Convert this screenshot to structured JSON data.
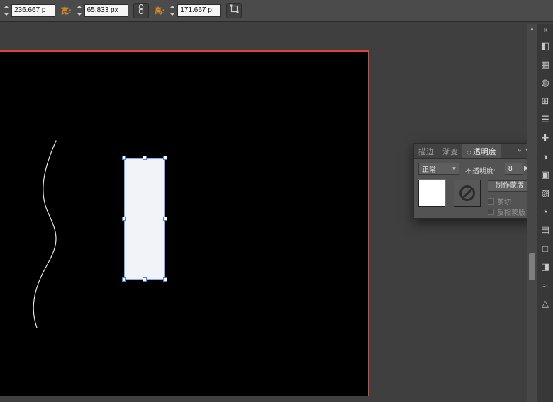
{
  "toolbar": {
    "x_field": "236.667 p",
    "width_label": "宽:",
    "width_field": "65.833 px",
    "height_label": "高:",
    "height_field": "171.667 p"
  },
  "panel": {
    "tabs": [
      {
        "label": "描边"
      },
      {
        "label": "渐变"
      },
      {
        "label": "透明度"
      }
    ],
    "active_tab_icon": "◇",
    "collapse_icon": "»",
    "menu_icon": "▾≡",
    "blend_mode_value": "正常",
    "blend_dropdown_arrow": "▼",
    "opacity_label": "不透明度:",
    "opacity_value": "8",
    "opacity_arrow": "▶",
    "make_mask_button": "制作蒙版",
    "clip_checkbox_label": "剪切",
    "invert_checkbox_label": "反相蒙版"
  },
  "dock": {
    "expand_icon": "«",
    "icons": [
      {
        "name": "color-panel-icon",
        "glyph": "◧"
      },
      {
        "name": "color-guide-panel-icon",
        "glyph": "▦"
      },
      {
        "name": "swatches-panel-icon",
        "glyph": "◍"
      },
      {
        "name": "brushes-panel-icon",
        "glyph": "⊞"
      },
      {
        "name": "symbols-panel-icon",
        "glyph": "☰"
      },
      {
        "name": "stroke-panel-icon",
        "glyph": "✚"
      },
      {
        "name": "gradient-panel-icon",
        "glyph": "◑"
      },
      {
        "name": "transparency-panel-icon",
        "glyph": "▣"
      },
      {
        "name": "appearance-panel-icon",
        "glyph": "▧"
      },
      {
        "name": "graphic-styles-panel-icon",
        "glyph": "◔"
      },
      {
        "name": "layers-panel-icon",
        "glyph": "▤"
      },
      {
        "name": "artboards-panel-icon",
        "glyph": "□"
      },
      {
        "name": "align-panel-icon",
        "glyph": "◨"
      },
      {
        "name": "pathfinder-panel-icon",
        "glyph": "≈"
      },
      {
        "name": "transform-panel-icon",
        "glyph": "△"
      }
    ]
  },
  "scrollbar": {
    "up_arrow": "▲"
  },
  "colors": {
    "artboard_border": "#dc4437",
    "selection_accent": "#86a8f0",
    "label_orange": "#d78e2e"
  }
}
